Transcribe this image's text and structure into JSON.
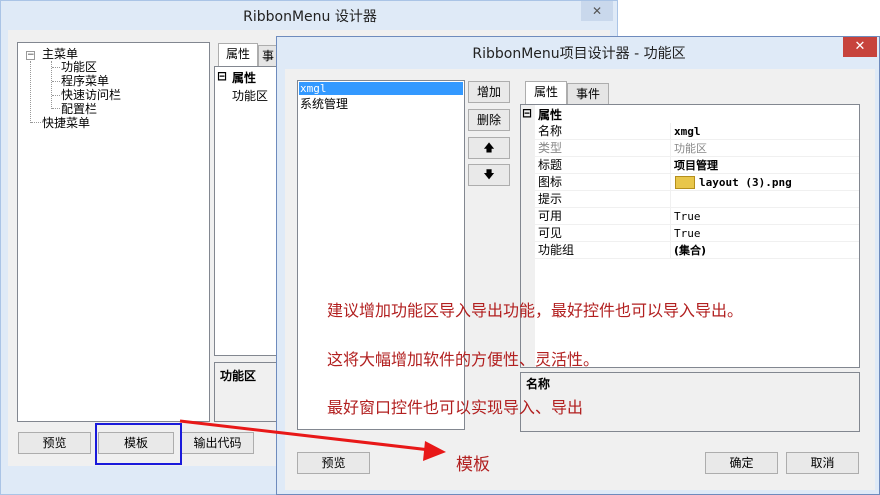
{
  "back_window": {
    "title": "RibbonMenu 设计器",
    "close_glyph": "✕",
    "tree": [
      {
        "label": "主菜单"
      },
      {
        "label": "功能区"
      },
      {
        "label": "程序菜单"
      },
      {
        "label": "快速访问栏"
      },
      {
        "label": "配置栏"
      },
      {
        "label": "快捷菜单"
      }
    ],
    "tree_toggle": "−",
    "tabs": [
      "属性",
      "事"
    ],
    "prop_section": "属性",
    "prop_item": "功能区",
    "desc_label": "功能区",
    "buttons": {
      "preview": "预览",
      "template": "模板",
      "export_code": "输出代码"
    }
  },
  "front_window": {
    "title": "RibbonMenu项目设计器 - 功能区",
    "close_glyph": "✕",
    "list_items": [
      "xmgl",
      "系统管理"
    ],
    "side_buttons": {
      "add": "增加",
      "delete": "删除",
      "up": "🡅",
      "down": "🡇"
    },
    "tabs": [
      "属性",
      "事件"
    ],
    "prop_section": "属性",
    "properties": [
      {
        "name": "名称",
        "value": "xmgl"
      },
      {
        "name": "类型",
        "value": "功能区"
      },
      {
        "name": "标题",
        "value": "项目管理"
      },
      {
        "name": "图标",
        "value": "layout (3).png"
      },
      {
        "name": "提示",
        "value": ""
      },
      {
        "name": "可用",
        "value": "True"
      },
      {
        "name": "可见",
        "value": "True"
      },
      {
        "name": "功能组",
        "value": "(集合)"
      }
    ],
    "desc_label": "名称",
    "buttons": {
      "preview": "预览",
      "ok": "确定",
      "cancel": "取消"
    }
  },
  "annotations": {
    "note1": "建议增加功能区导入导出功能，最好控件也可以导入导出。",
    "note2": "这将大幅增加软件的方便性、灵活性。",
    "note3": "最好窗口控件也可以实现导入、导出",
    "arrow_label": "模板",
    "note_color": "#b22020",
    "arrow_color": "#e81818",
    "highlight_color": "#1a1adb"
  }
}
